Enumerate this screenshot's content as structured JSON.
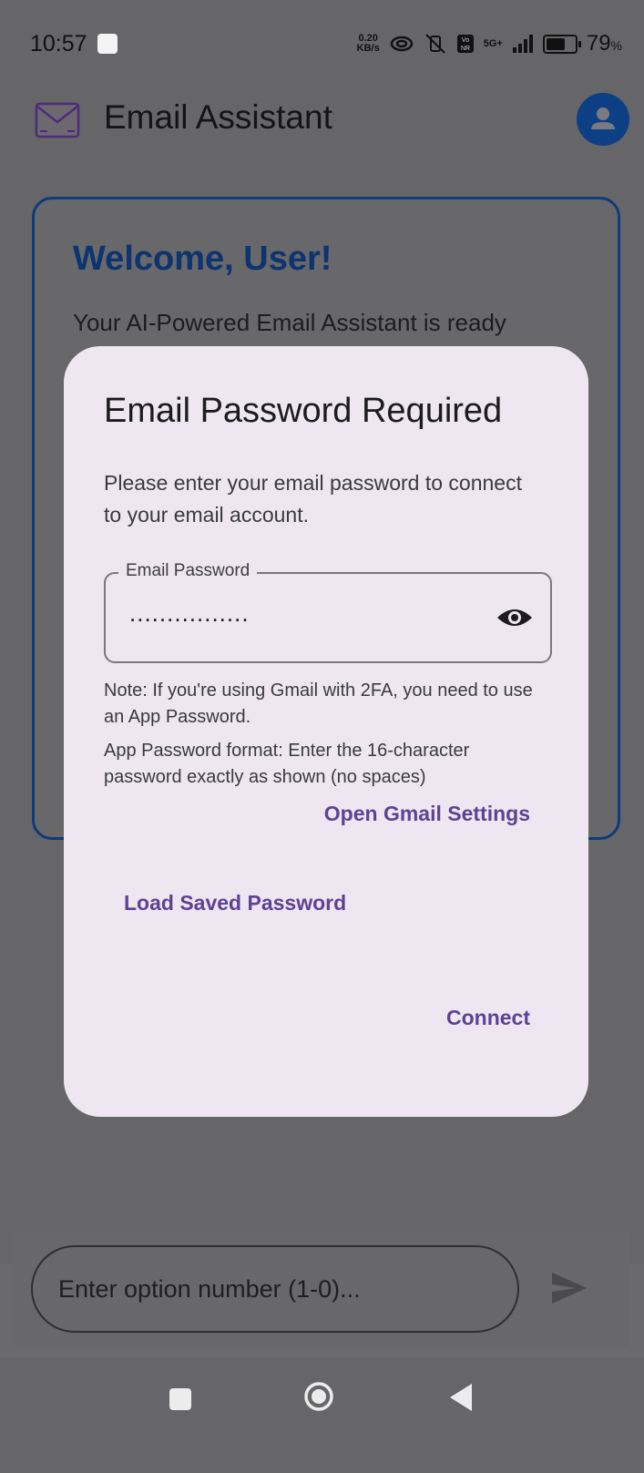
{
  "status_bar": {
    "time": "10:57",
    "net_speed_value": "0.20",
    "net_speed_unit": "KB/s",
    "network": "5G+",
    "battery_percent": "79",
    "battery_unit": "%",
    "battery_level": 0.79
  },
  "app_bar": {
    "title": "Email Assistant",
    "logo_icon": "email-envelope-icon",
    "account_icon": "account-icon"
  },
  "welcome_card": {
    "title": "Welcome, User!",
    "subtitle": "Your AI-Powered Email Assistant is ready"
  },
  "dialog": {
    "title": "Email Password Required",
    "body": "Please enter your email password to connect to your email account.",
    "password_field": {
      "label": "Email Password",
      "value_masked": "................"
    },
    "note": "Note: If you're using Gmail with 2FA, you need to use an App Password.",
    "format_note": "App Password format: Enter the 16-character password exactly as shown (no spaces)",
    "open_gmail_settings": "Open Gmail Settings",
    "load_saved_password": "Load Saved Password",
    "connect": "Connect"
  },
  "chat_input": {
    "placeholder": "Enter option number (1-0)..."
  },
  "colors": {
    "accent": "#5e4294",
    "brand_blue": "#0c3f84",
    "dialog_bg": "#eee7f1"
  }
}
